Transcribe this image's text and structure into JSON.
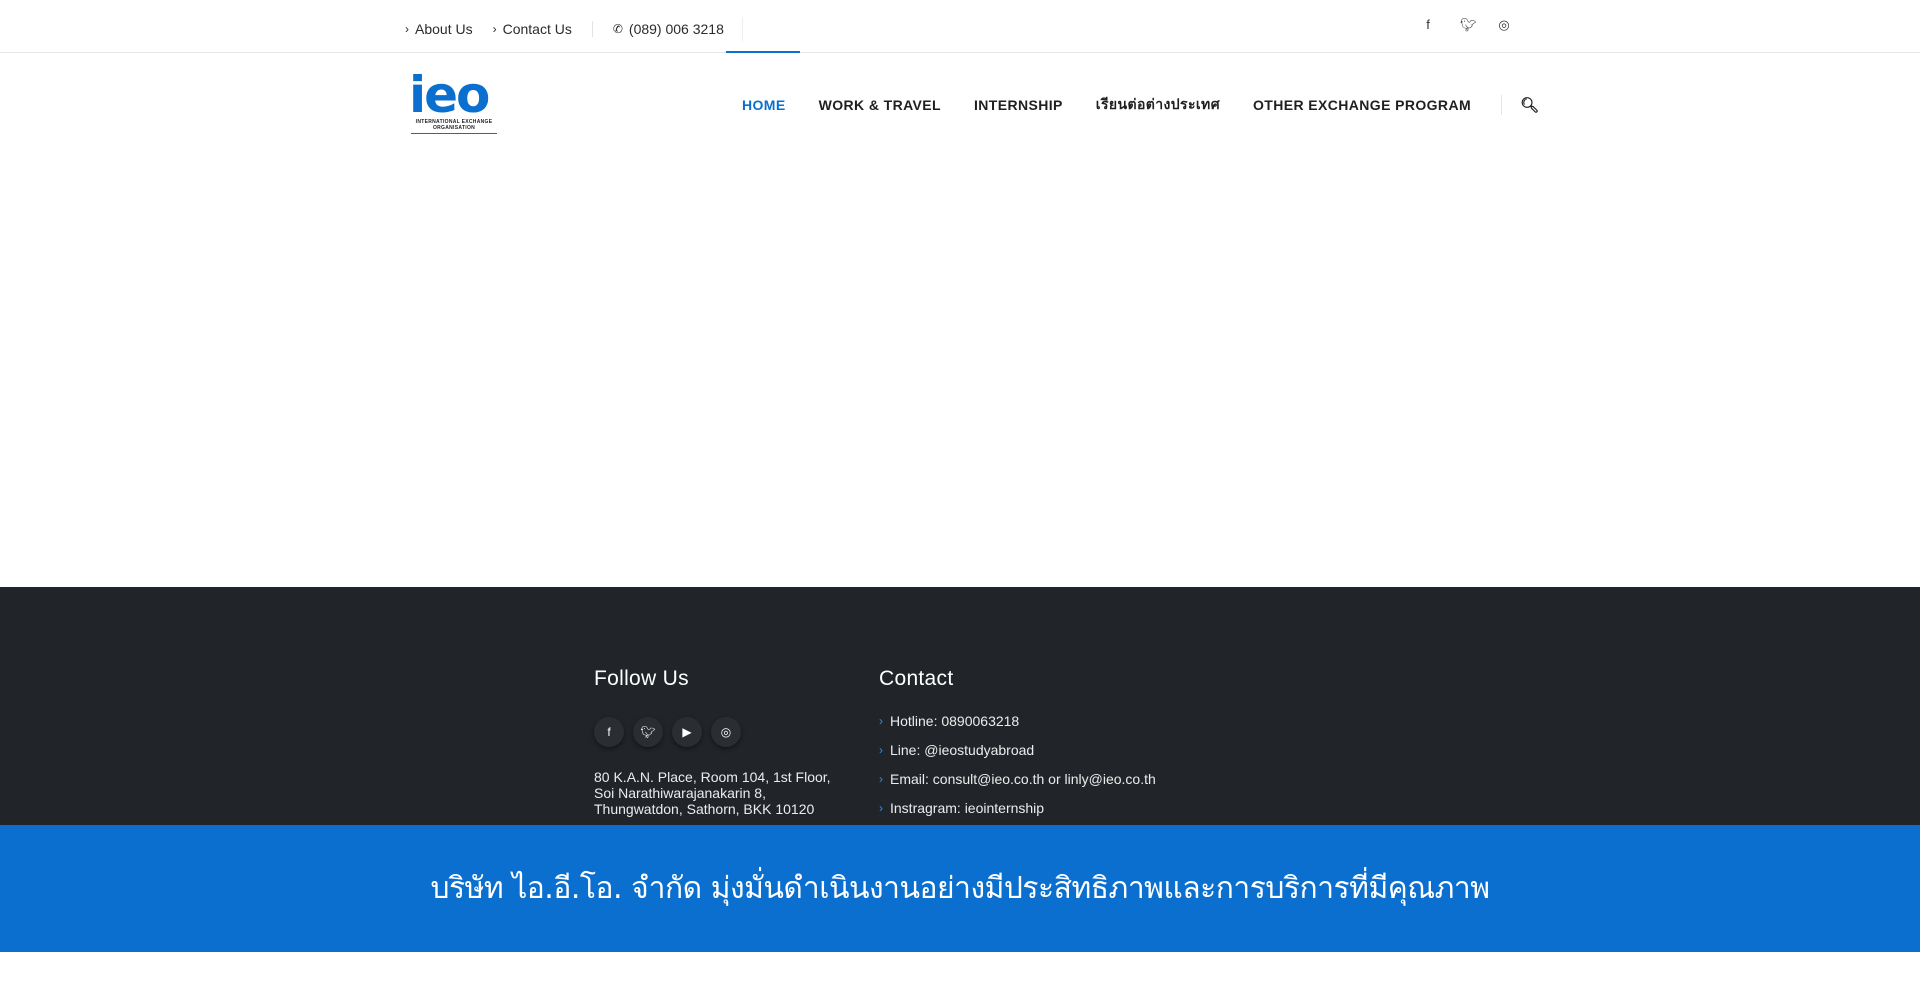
{
  "topbar": {
    "links": [
      "About Us",
      "Contact Us"
    ],
    "phone": "(089) 006 3218",
    "social_icons": [
      "facebook-icon",
      "twitter-icon",
      "instagram-icon"
    ]
  },
  "header": {
    "logo_text": "ieo",
    "logo_subtext": "INTERNATIONAL EXCHANGE ORGANISATION",
    "nav": [
      "HOME",
      "WORK & TRAVEL",
      "INTERNSHIP",
      "เรียนต่อต่างประเทศ",
      "OTHER EXCHANGE PROGRAM"
    ],
    "active_nav": "HOME",
    "accent_color": "#0a6fcf"
  },
  "footer": {
    "follow_title": "Follow Us",
    "follow_icons": [
      "facebook-icon",
      "twitter-icon",
      "youtube-icon",
      "instagram-icon"
    ],
    "address_lines": [
      "80 K.A.N. Place, Room 104, 1st Floor,",
      "Soi Narathiwarajanakarin 8,",
      "Thungwatdon, Sathorn, BKK 10120"
    ],
    "contact_title": "Contact",
    "contact_items": [
      "Hotline: 0890063218",
      "Line: @ieostudyabroad",
      "Email: consult@ieo.co.th or linly@ieo.co.th",
      "Instragram: ieointernship"
    ],
    "background": "#212529"
  },
  "banner": {
    "text": "บริษัท ไอ.อี.โอ. จำกัด มุ่งมั่นดำเนินงานอย่างมีประสิทธิภาพและการบริการที่มีคุณภาพ",
    "background": "#0a6fcf"
  }
}
